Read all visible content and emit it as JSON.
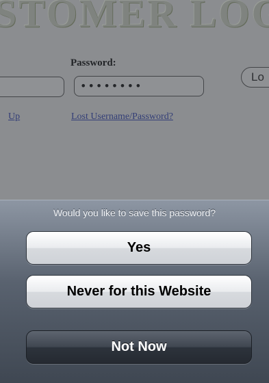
{
  "page": {
    "banner_text": "STOMER LOG",
    "password_label": "Password:",
    "password_value": "••••••••",
    "login_button_label": "Lo",
    "signup_link": "Up",
    "lost_link": "Lost Username/Password?"
  },
  "sheet": {
    "title": "Would you like to save this password?",
    "buttons": {
      "yes": "Yes",
      "never": "Never for this Website",
      "not_now": "Not Now"
    }
  },
  "colors": {
    "link": "#3b4aa0",
    "sheet_top": "#8d96a3",
    "sheet_bottom": "#3f4752"
  }
}
